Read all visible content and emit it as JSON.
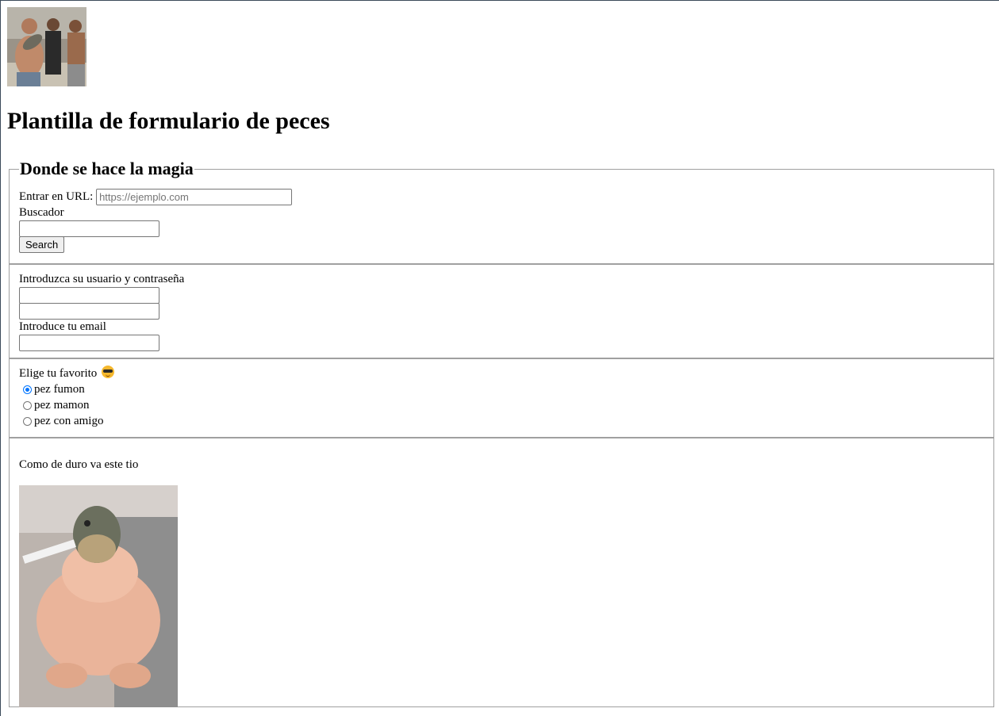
{
  "header": {
    "logo_alt": "photo of three men holding a fish",
    "title": "Plantilla de formulario de peces"
  },
  "search_section": {
    "legend": "Donde se hace la magia",
    "url_label": "Entrar en URL:",
    "url_placeholder": "https://ejemplo.com",
    "url_value": "",
    "search_label": "Buscador",
    "search_value": "",
    "search_button": "Search"
  },
  "login_section": {
    "label": "Introduzca su usuario y contraseña",
    "username_value": "",
    "password_value": "",
    "email_label": "Introduce tu email",
    "email_value": ""
  },
  "favorite_section": {
    "label": "Elige tu favorito",
    "emoji": "smiling-face-with-sunglasses-icon",
    "options": [
      {
        "label": "pez fumon",
        "checked": true
      },
      {
        "label": "pez mamon",
        "checked": false
      },
      {
        "label": "pez con amigo",
        "checked": false
      }
    ]
  },
  "image_section": {
    "caption": "Como de duro va este tio",
    "image_alt": "fish head on a plucked chicken body smoking a cigarette"
  },
  "colors": {
    "radio_accent": "#0075ff",
    "border": "#a0a0a0"
  }
}
